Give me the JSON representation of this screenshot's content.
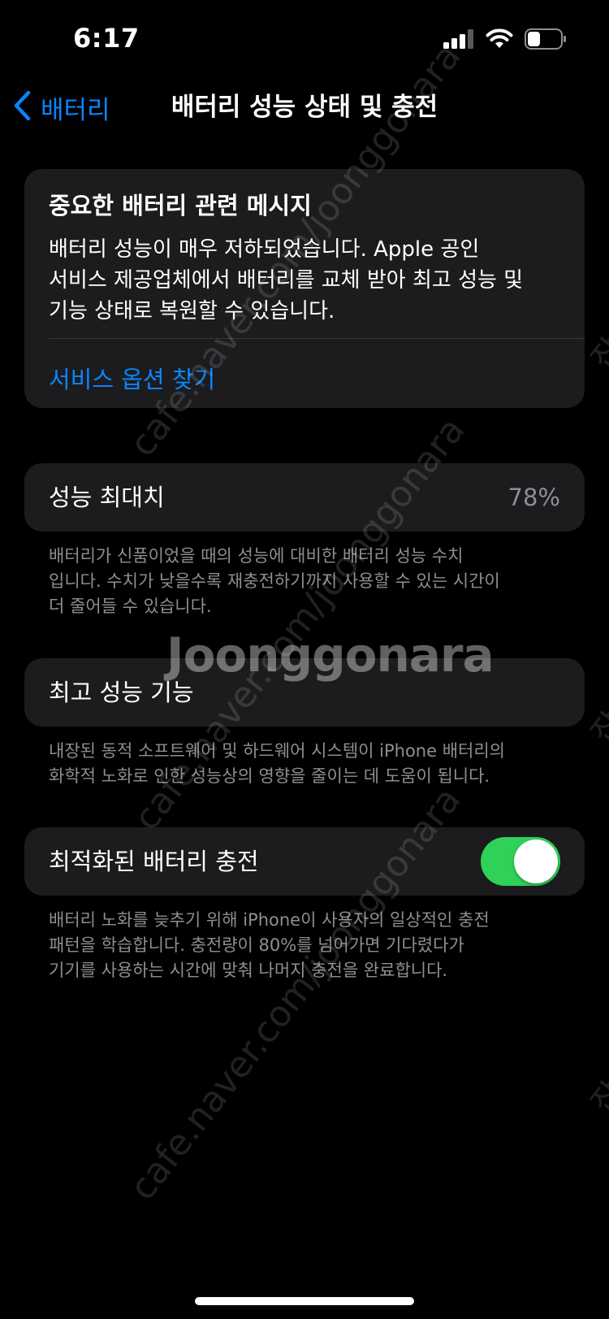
{
  "status_bar": {
    "time": "6:17",
    "icons": [
      "cellular-signal-icon",
      "wifi-icon",
      "battery-icon"
    ]
  },
  "nav": {
    "back_label": "배터리",
    "title": "배터리 성능 상태 및 충전"
  },
  "message": {
    "title": "중요한 배터리 관련 메시지",
    "body": "배터리 성능이 매우 저하되었습니다. Apple 공인\n서비스 제공업체에서 배터리를 교체 받아 최고 성능 및\n기능 상태로 복원할 수 있습니다.",
    "link": "서비스 옵션 찾기"
  },
  "max_capacity": {
    "label": "성능 최대치",
    "value": "78%",
    "footnote": "배터리가 신품이었을 때의 성능에 대비한 배터리 성능 수치\n입니다. 수치가 낮을수록 재충전하기까지 사용할 수 있는 시간이\n더 줄어들 수 있습니다."
  },
  "peak_performance": {
    "label": "최고 성능 기능",
    "footnote": "내장된 동적 소프트웨어 및 하드웨어 시스템이 iPhone 배터리의\n화학적 노화로 인한 성능상의 영향을 줄이는 데 도움이 됩니다."
  },
  "optimized_charging": {
    "label": "최적화된 배터리 충전",
    "enabled": true,
    "footnote": "배터리 노화를 늦추기 위해 iPhone이 사용자의 일상적인 충전\n패턴을 학습합니다. 충전량이 80%를 넘어가면 기다렸다가\n기기를 사용하는 시간에 맞춰 나머지 충전을 완료합니다."
  },
  "watermark": {
    "brand": "Joonggonara",
    "url": "cafe.naver.com/joonggonara",
    "side": "잡써"
  },
  "colors": {
    "background": "#000000",
    "card": "#1c1c1e",
    "accent": "#0a84ff",
    "toggle_on": "#30d158",
    "secondary_text": "#8e8e93"
  }
}
